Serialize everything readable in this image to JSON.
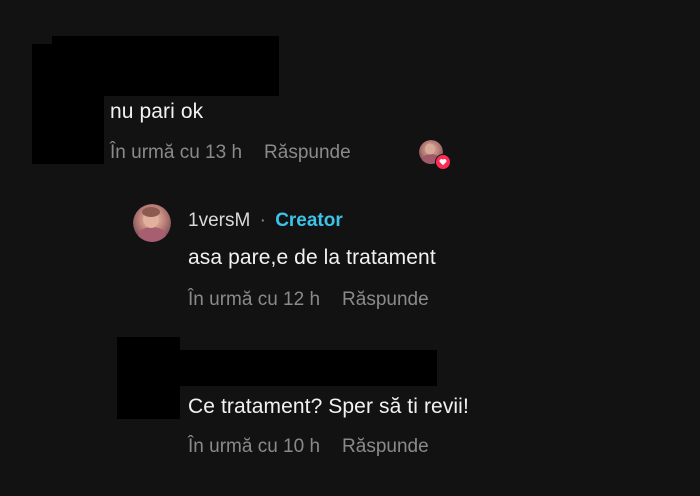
{
  "comments": [
    {
      "text": "nu pari ok",
      "time": "În urmă cu 13 h",
      "reply_label": "Răspunde"
    },
    {
      "username": "1versM",
      "separator": "·",
      "badge": "Creator",
      "text": "asa pare,e de la tratament",
      "time": "În urmă cu 12 h",
      "reply_label": "Răspunde"
    },
    {
      "text": "Ce tratament? Sper să ti revii!",
      "time": "În urmă cu 10 h",
      "reply_label": "Răspunde"
    }
  ],
  "colors": {
    "background": "#121212",
    "redaction": "#000000",
    "creator_badge": "#3cc3e8",
    "like_heart": "#fe2c55"
  },
  "icons": {
    "liked_by_creator": "creator-avatar-with-heart-icon",
    "creator_avatar": "creator-avatar-icon"
  }
}
